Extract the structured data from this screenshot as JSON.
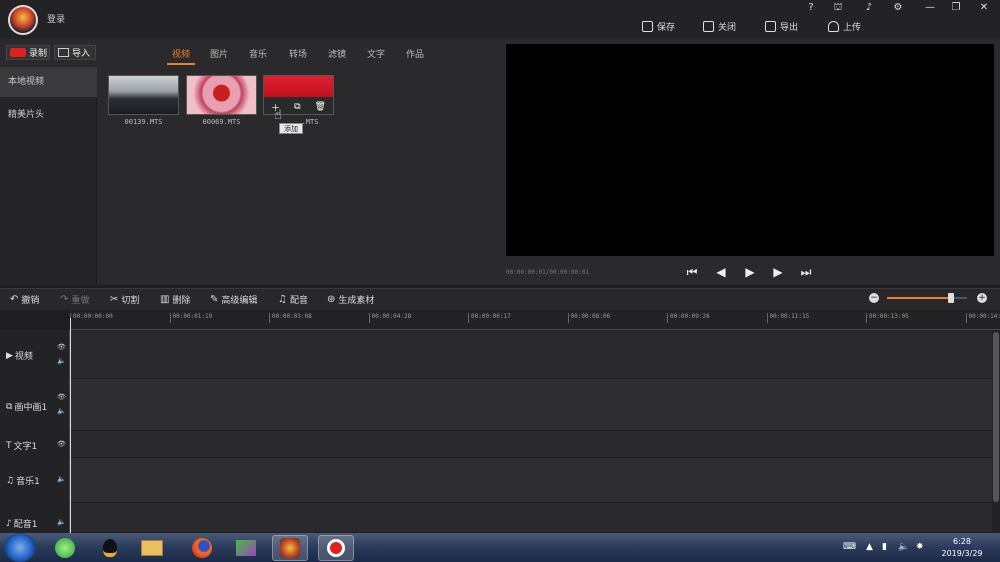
{
  "titlebar": {
    "login": "登录"
  },
  "window_controls": [
    "?",
    "☗",
    "🔔",
    "⚙",
    "—",
    "❐",
    "✕"
  ],
  "top_actions": [
    {
      "label": "保存",
      "icon": "save-icon"
    },
    {
      "label": "关闭",
      "icon": "exit-icon"
    },
    {
      "label": "导出",
      "icon": "export-icon"
    },
    {
      "label": "上传",
      "icon": "upload-icon"
    }
  ],
  "media": {
    "record_label": "录制",
    "import_label": "导入",
    "tabs": [
      "视频",
      "图片",
      "音乐",
      "转场",
      "滤镜",
      "文字",
      "作品"
    ],
    "active_tab": "视频",
    "sidebar": [
      "本地视频",
      "精美片头"
    ],
    "files": [
      "00139.MTS",
      "00069.MTS",
      ".MTS"
    ],
    "tooltip": "添加"
  },
  "preview": {
    "timecode": "00:00:00:01/00:00:00:01"
  },
  "toolbar": {
    "undo": "撤销",
    "redo": "重做",
    "cut": "切割",
    "delete": "删除",
    "advanced_edit": "高级编辑",
    "dub": "配音",
    "generate": "生成素材",
    "zoom_level": 0.8
  },
  "ruler": [
    "00:00:00:00",
    "00:00:01:19",
    "00:00:03:08",
    "00:00:04:28",
    "00:00:06:17",
    "00:00:08:06",
    "00:00:09:26",
    "00:00:11:15",
    "00:00:13:05",
    "00:00:14:"
  ],
  "tracks": [
    "视频",
    "画中画1",
    "文字1",
    "音乐1",
    "配音1"
  ],
  "taskbar": {
    "time": "6:28",
    "date": "2019/3/29"
  },
  "colors": {
    "accent": "#f07d28",
    "record": "#e02020"
  }
}
